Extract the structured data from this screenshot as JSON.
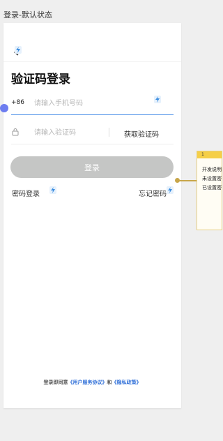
{
  "frame_title": "登录-默认状态",
  "page_title": "验证码登录",
  "phone": {
    "prefix": "+86",
    "placeholder": "请输入手机号码",
    "value": ""
  },
  "code": {
    "placeholder": "请输入验证码",
    "value": "",
    "get_code_label": "获取验证码"
  },
  "login_button": "登录",
  "links": {
    "password_login": "密码登录",
    "forgot_password": "忘记密码"
  },
  "agreement": {
    "prefix": "登录即同意",
    "user_agreement": "《用户服务协议》",
    "and": "和",
    "privacy_policy": "《隐私政策》"
  },
  "note": {
    "index": "1",
    "lines": [
      "开发说明",
      "未设置密",
      "已设置密"
    ]
  },
  "colors": {
    "accent_blue": "#4a8fe8",
    "button_disabled": "#c5c6c5",
    "link_blue": "#2f6fd8",
    "note_yellow": "#f5cf48",
    "anchor_purple": "#6d7df0"
  },
  "icons": {
    "back": "back-arrow-icon",
    "lock": "lock-icon",
    "annotation": "bolt-icon"
  }
}
